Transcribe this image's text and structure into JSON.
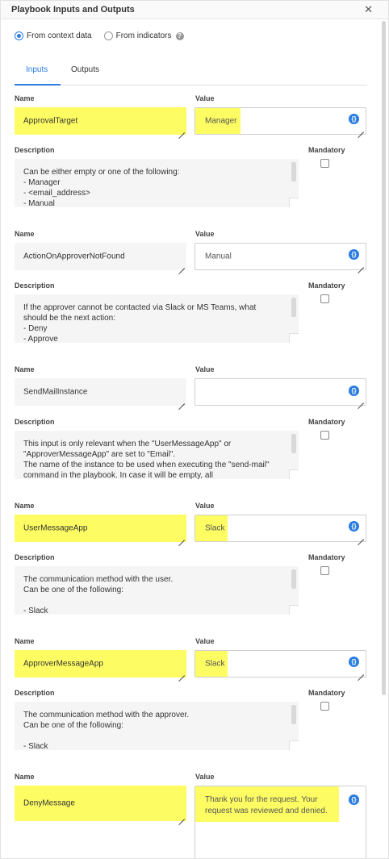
{
  "header": {
    "title": "Playbook Inputs and Outputs",
    "close_glyph": "✕"
  },
  "source": {
    "options": [
      {
        "label": "From context data",
        "selected": true
      },
      {
        "label": "From indicators",
        "selected": false
      }
    ],
    "help_glyph": "?"
  },
  "tabs": [
    {
      "label": "Inputs",
      "active": true
    },
    {
      "label": "Outputs",
      "active": false
    }
  ],
  "labels": {
    "name": "Name",
    "value": "Value",
    "description": "Description",
    "mandatory": "Mandatory",
    "context_button": "{}"
  },
  "inputs": [
    {
      "name": "ApprovalTarget",
      "value": "Manager",
      "highlighted": true,
      "description": "Can be either empty or one of the following:\n- Manager\n- <email_address>\n- Manual",
      "mandatory": false
    },
    {
      "name": "ActionOnApproverNotFound",
      "value": "Manual",
      "highlighted": false,
      "description": "If the approver cannot be contacted via Slack or MS Teams, what should be the next action:\n- Deny\n- Approve",
      "mandatory": false
    },
    {
      "name": "SendMailInstance",
      "value": "",
      "highlighted": false,
      "description": "This input is only relevant when the \"UserMessageApp\" or \"ApproverMessageApp\" are set to \"Email\".\nThe name of the instance to be used when executing the \"send-mail\" command in the playbook. In case it will be empty, all",
      "mandatory": false
    },
    {
      "name": "UserMessageApp",
      "value": "Slack",
      "highlighted": true,
      "description": "The communication method with the user.\nCan be one of the following:\n\n- Slack",
      "mandatory": false
    },
    {
      "name": "ApproverMessageApp",
      "value": "Slack",
      "highlighted": true,
      "description": "The communication method with the approver.\nCan be one of the following:\n\n- Slack",
      "mandatory": false
    },
    {
      "name": "DenyMessage",
      "value": "Thank you for the request. Your request was reviewed and denied.",
      "highlighted": true
    }
  ],
  "colors": {
    "accent": "#2a7de1",
    "highlight": "#fdfd63"
  }
}
